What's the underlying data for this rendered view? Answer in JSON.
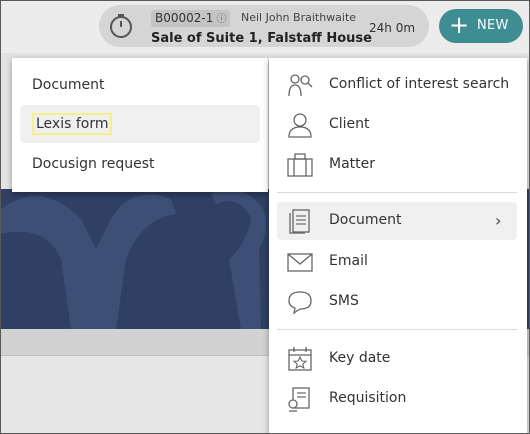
{
  "timer": {
    "matter_code": "B00002-1",
    "client_name": "Neil John Braithwaite",
    "matter_description": "Sale of Suite 1, Falstaff House",
    "elapsed": "24h 0m"
  },
  "new_button": {
    "label": "NEW",
    "icon": "plus-icon",
    "color": "#3d8d93"
  },
  "submenu": {
    "items": [
      {
        "label": "Document"
      },
      {
        "label": "Lexis form"
      },
      {
        "label": "Docusign request"
      }
    ]
  },
  "menu": {
    "items": [
      {
        "label": "Conflict of interest search",
        "icon": "people-search-icon"
      },
      {
        "label": "Client",
        "icon": "person-icon"
      },
      {
        "label": "Matter",
        "icon": "briefcase-icon"
      },
      {
        "label": "Document",
        "icon": "document-icon"
      },
      {
        "label": "Email",
        "icon": "envelope-icon"
      },
      {
        "label": "SMS",
        "icon": "chat-bubble-icon"
      },
      {
        "label": "Key date",
        "icon": "calendar-star-icon"
      },
      {
        "label": "Requisition",
        "icon": "requisition-icon"
      }
    ]
  },
  "colors": {
    "hero": "#2f4064",
    "highlight": "#f4f287"
  }
}
